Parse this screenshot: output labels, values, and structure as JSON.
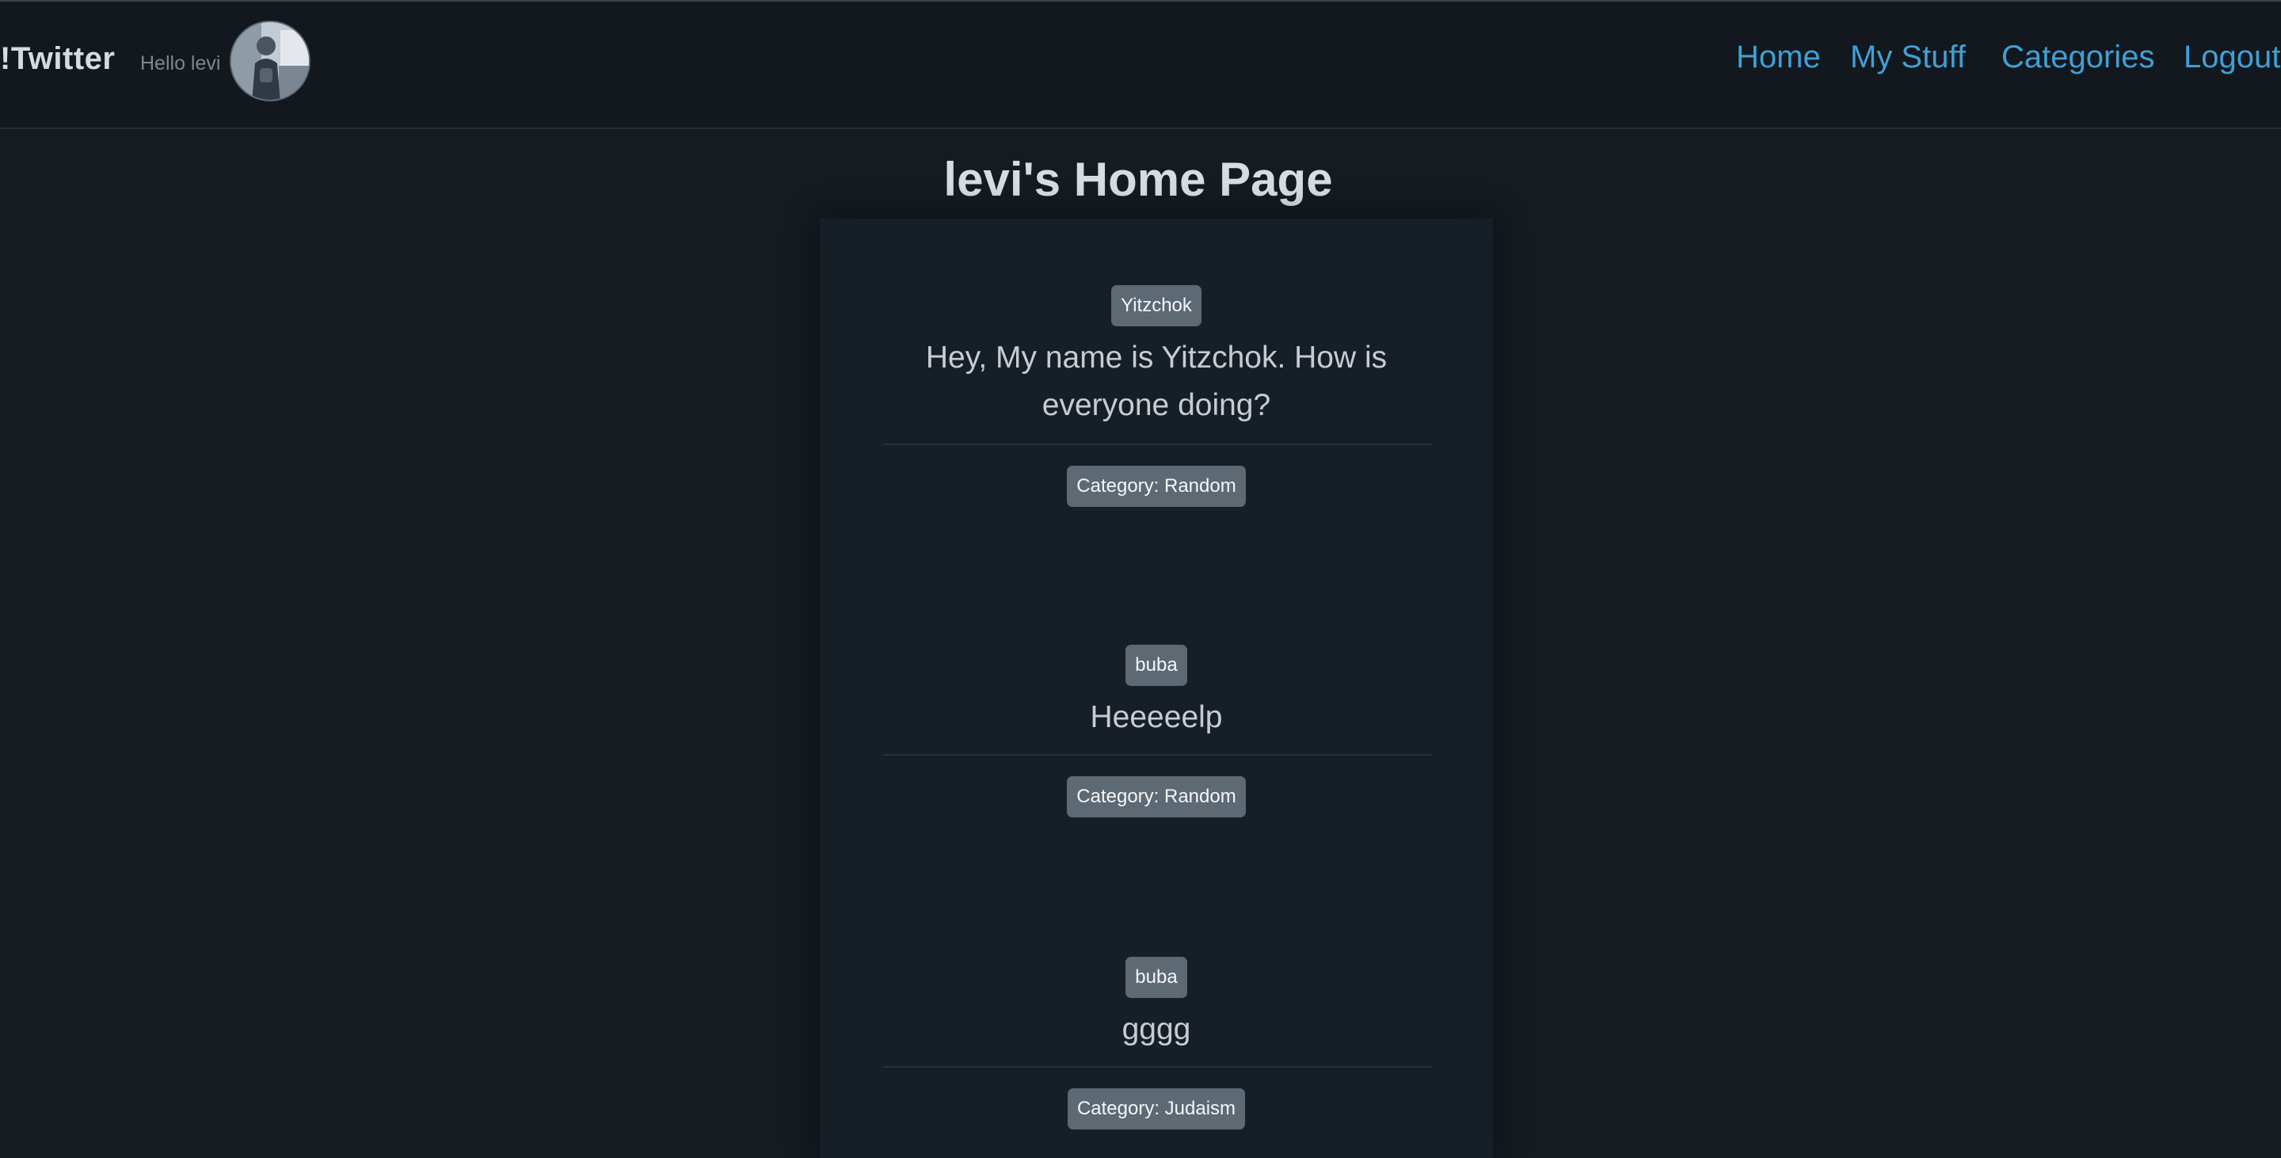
{
  "navbar": {
    "brand": "!Twitter",
    "greeting": "Hello levi",
    "avatar_icon": "user-avatar-icon",
    "links": [
      "Home",
      "My Stuff",
      "Categories",
      "Logout"
    ]
  },
  "page": {
    "title": "levi's Home Page"
  },
  "posts": [
    {
      "author": "Yitzchok",
      "content": "Hey, My name is Yitzchok. How is everyone doing?",
      "category": "Category: Random"
    },
    {
      "author": "buba",
      "content": "Heeeeelp",
      "category": "Category: Random"
    },
    {
      "author": "buba",
      "content": "gggg",
      "category": "Category: Judaism"
    }
  ],
  "colors": {
    "background": "#141b21",
    "navbar": "#12181d",
    "link": "#3fa0d6",
    "badge": "#5d6973"
  }
}
